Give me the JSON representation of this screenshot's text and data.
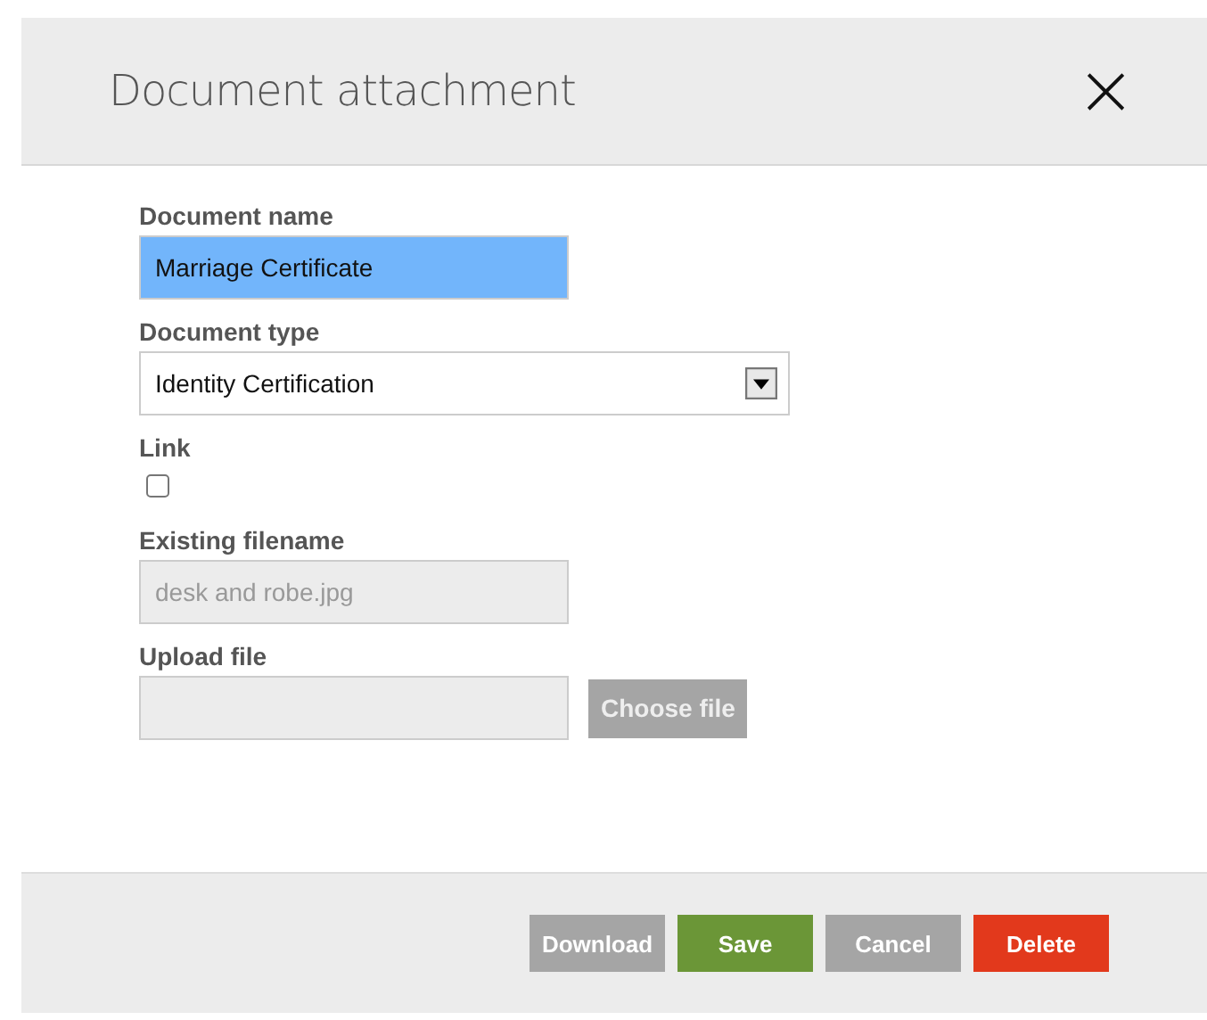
{
  "dialog": {
    "title": "Document attachment",
    "close": "×"
  },
  "fields": [
    {
      "kind": "text",
      "label": "Document name",
      "value": "Marriage Certificate",
      "selected": true
    },
    {
      "kind": "select",
      "label": "Document type",
      "value": "Identity Certification"
    },
    {
      "kind": "checkbox",
      "label": "Link",
      "checked": false
    },
    {
      "kind": "readonly",
      "label": "Existing filename",
      "value": "desk and robe.jpg"
    },
    {
      "kind": "file",
      "label": "Upload file",
      "button": "Choose file"
    }
  ],
  "buttons": [
    {
      "label": "Download",
      "kind": "neutral"
    },
    {
      "label": "Save",
      "kind": "primary"
    },
    {
      "label": "Cancel",
      "kind": "neutral"
    },
    {
      "label": "Delete",
      "kind": "danger"
    }
  ]
}
